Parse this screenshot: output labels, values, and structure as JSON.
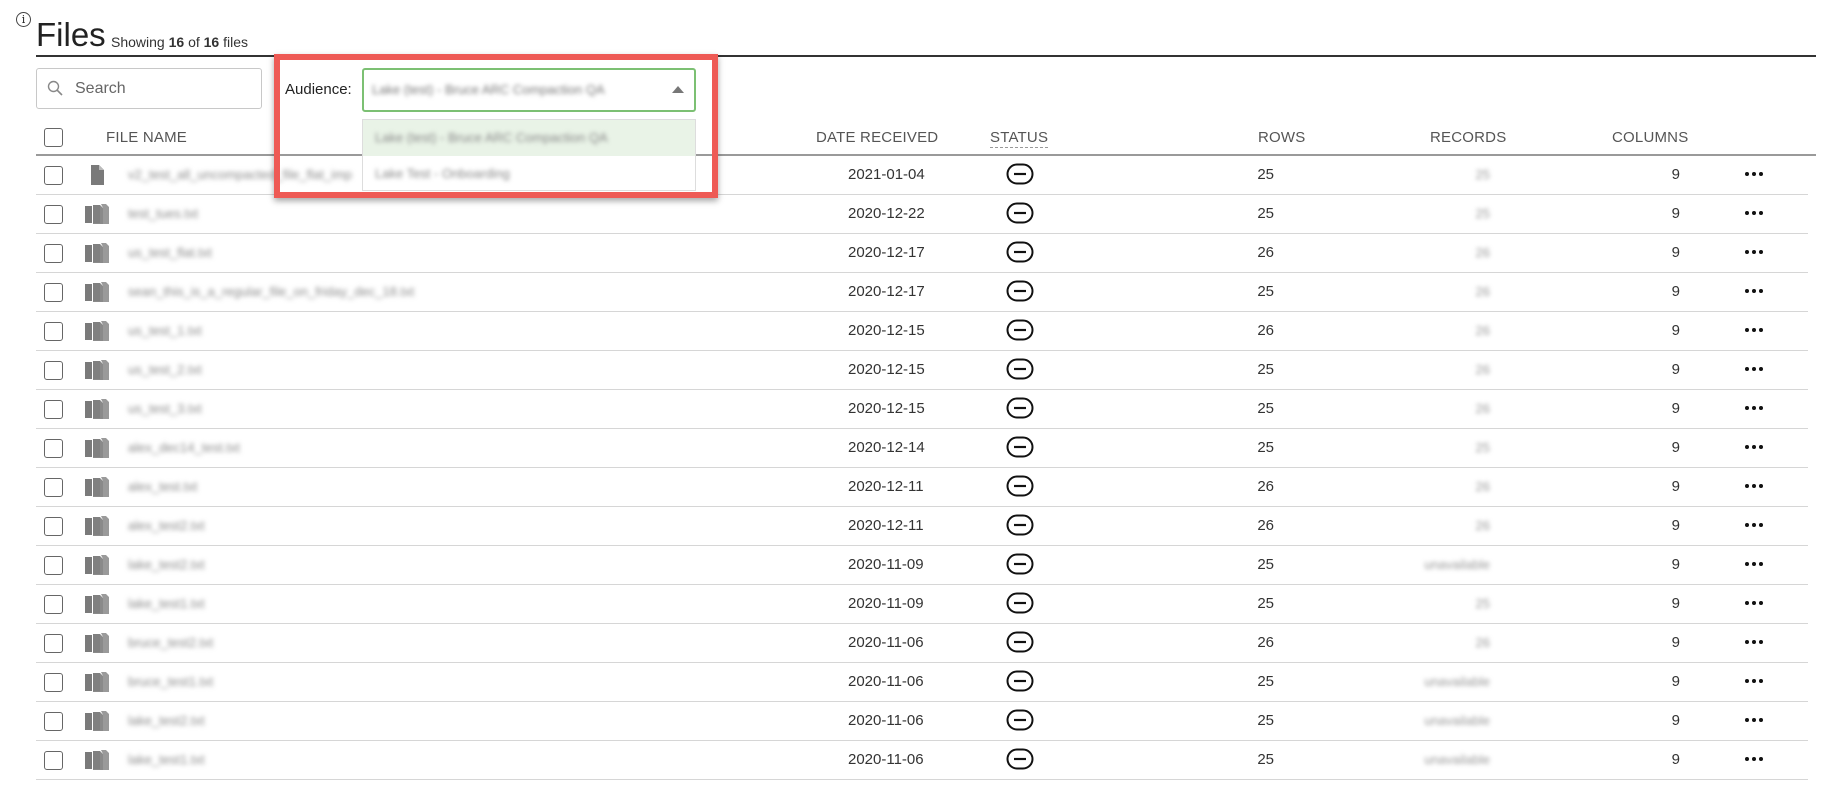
{
  "header": {
    "title": "Files",
    "showing_prefix": "Showing",
    "shown_count": "16",
    "of_word": "of",
    "total_count": "16",
    "files_word": "files"
  },
  "search": {
    "placeholder": "Search",
    "value": ""
  },
  "audience": {
    "label": "Audience:",
    "selected": "Lake (test) - Bruce ARC Compaction QA",
    "options": [
      "Lake (test) - Bruce ARC Compaction QA",
      "Lake Test - Onboarding"
    ]
  },
  "columns": {
    "file_name": "FILE NAME",
    "date_received": "DATE RECEIVED",
    "status": "STATUS",
    "rows": "ROWS",
    "records": "RECORDS",
    "columns": "COLUMNS"
  },
  "files": [
    {
      "name": "v2_test_all_uncompacted_file_flat_imp",
      "type": "single",
      "date": "2021-01-04",
      "rows": "25",
      "records": "25",
      "columns": "9"
    },
    {
      "name": "test_tues.txt",
      "type": "multi",
      "date": "2020-12-22",
      "rows": "25",
      "records": "25",
      "columns": "9"
    },
    {
      "name": "us_test_flat.txt",
      "type": "multi",
      "date": "2020-12-17",
      "rows": "26",
      "records": "26",
      "columns": "9"
    },
    {
      "name": "sean_this_is_a_regular_file_on_friday_dec_18.txt",
      "type": "multi",
      "date": "2020-12-17",
      "rows": "25",
      "records": "26",
      "columns": "9"
    },
    {
      "name": "us_test_1.txt",
      "type": "multi",
      "date": "2020-12-15",
      "rows": "26",
      "records": "26",
      "columns": "9"
    },
    {
      "name": "us_test_2.txt",
      "type": "multi",
      "date": "2020-12-15",
      "rows": "25",
      "records": "26",
      "columns": "9"
    },
    {
      "name": "us_test_3.txt",
      "type": "multi",
      "date": "2020-12-15",
      "rows": "25",
      "records": "26",
      "columns": "9"
    },
    {
      "name": "alex_dec14_test.txt",
      "type": "multi",
      "date": "2020-12-14",
      "rows": "25",
      "records": "25",
      "columns": "9"
    },
    {
      "name": "alex_test.txt",
      "type": "multi",
      "date": "2020-12-11",
      "rows": "26",
      "records": "26",
      "columns": "9"
    },
    {
      "name": "alex_test2.txt",
      "type": "multi",
      "date": "2020-12-11",
      "rows": "26",
      "records": "26",
      "columns": "9"
    },
    {
      "name": "lake_test2.txt",
      "type": "multi",
      "date": "2020-11-09",
      "rows": "25",
      "records": "unavailable",
      "columns": "9"
    },
    {
      "name": "lake_test1.txt",
      "type": "multi",
      "date": "2020-11-09",
      "rows": "25",
      "records": "25",
      "columns": "9"
    },
    {
      "name": "bruce_test2.txt",
      "type": "multi",
      "date": "2020-11-06",
      "rows": "26",
      "records": "26",
      "columns": "9"
    },
    {
      "name": "bruce_test1.txt",
      "type": "multi",
      "date": "2020-11-06",
      "rows": "25",
      "records": "unavailable",
      "columns": "9"
    },
    {
      "name": "lake_test2.txt",
      "type": "multi",
      "date": "2020-11-06",
      "rows": "25",
      "records": "unavailable",
      "columns": "9"
    },
    {
      "name": "lake_test1.txt",
      "type": "multi",
      "date": "2020-11-06",
      "rows": "25",
      "records": "unavailable",
      "columns": "9"
    }
  ],
  "icons": {
    "info": "info-icon",
    "search": "search-icon",
    "dropdown": "caret-up-icon",
    "file_single": "file-icon",
    "file_multi": "multi-file-icon",
    "status": "status-minus-icon",
    "row_actions": "more-options-icon"
  },
  "colors": {
    "highlight_border": "#ee5a55",
    "select_border": "#7cc073",
    "selected_option_bg": "#e9f3e7"
  }
}
